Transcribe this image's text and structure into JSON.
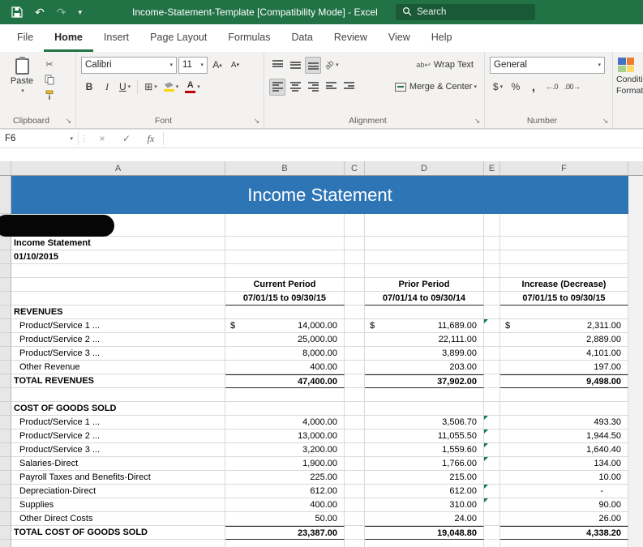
{
  "titlebar": {
    "title": "Income-Statement-Template [Compatibility Mode] - Excel",
    "search_placeholder": "Search"
  },
  "menubar": {
    "tabs": [
      "File",
      "Home",
      "Insert",
      "Page Layout",
      "Formulas",
      "Data",
      "Review",
      "View",
      "Help"
    ]
  },
  "ribbon": {
    "groups": {
      "clipboard": "Clipboard",
      "font": "Font",
      "alignment": "Alignment",
      "number": "Number"
    },
    "paste_label": "Paste",
    "font_name": "Calibri",
    "font_size": "11",
    "wrap_text": "Wrap Text",
    "merge_center": "Merge & Center",
    "number_format": "General",
    "cf_line1": "Conditional",
    "cf_line2": "Formatting"
  },
  "formula_bar": {
    "name_box": "F6"
  },
  "icons": {
    "undo": "↶",
    "redo": "↷",
    "dropdown": "▾",
    "up_small": "▴",
    "scissors": "✂",
    "bold": "B",
    "italic": "I",
    "underline": "U",
    "grow_font": "A",
    "shrink_font": "A",
    "borders": "⊞",
    "font_color_letter": "A",
    "orientation": "ab",
    "wrap_ab": "ab",
    "wrap_arrow": "↩",
    "dollar": "$",
    "percent": "%",
    "comma": ",",
    "increase_decimal": "←.0",
    "decrease_decimal": ".00→",
    "launcher": "↘",
    "cancel": "×",
    "enter": "✓",
    "fx": "fx",
    "dots": "⋮"
  },
  "sheet": {
    "col_headers": [
      "A",
      "B",
      "C",
      "D",
      "E",
      "F"
    ],
    "banner": "Income Statement",
    "doc_title": "Income Statement",
    "doc_date": "01/10/2015",
    "currency_symbol": "$",
    "periods": {
      "current": {
        "title": "Current Period",
        "range": "07/01/15 to 09/30/15"
      },
      "prior": {
        "title": "Prior Period",
        "range": "07/01/14 to 09/30/14"
      },
      "increase": {
        "title": "Increase (Decrease)",
        "range": "07/01/15 to 09/30/15"
      }
    },
    "revenues": {
      "header": "REVENUES",
      "rows": [
        {
          "label": "Product/Service 1 ...",
          "current": "14,000.00",
          "prior": "11,689.00",
          "increase": "2,311.00"
        },
        {
          "label": "Product/Service 2 ...",
          "current": "25,000.00",
          "prior": "22,111.00",
          "increase": "2,889.00"
        },
        {
          "label": "Product/Service 3 ...",
          "current": "8,000.00",
          "prior": "3,899.00",
          "increase": "4,101.00"
        },
        {
          "label": "Other Revenue",
          "current": "400.00",
          "prior": "203.00",
          "increase": "197.00"
        }
      ],
      "total": {
        "label": "TOTAL REVENUES",
        "current": "47,400.00",
        "prior": "37,902.00",
        "increase": "9,498.00"
      }
    },
    "cogs": {
      "header": "COST OF GOODS SOLD",
      "rows": [
        {
          "label": "Product/Service 1 ...",
          "current": "4,000.00",
          "prior": "3,506.70",
          "increase": "493.30"
        },
        {
          "label": "Product/Service 2 ...",
          "current": "13,000.00",
          "prior": "11,055.50",
          "increase": "1,944.50"
        },
        {
          "label": "Product/Service 3 ...",
          "current": "3,200.00",
          "prior": "1,559.60",
          "increase": "1,640.40"
        },
        {
          "label": "Salaries-Direct",
          "current": "1,900.00",
          "prior": "1,766.00",
          "increase": "134.00"
        },
        {
          "label": "Payroll Taxes and Benefits-Direct",
          "current": "225.00",
          "prior": "215.00",
          "increase": "10.00"
        },
        {
          "label": "Depreciation-Direct",
          "current": "612.00",
          "prior": "612.00",
          "increase": "-"
        },
        {
          "label": "Supplies",
          "current": "400.00",
          "prior": "310.00",
          "increase": "90.00"
        },
        {
          "label": "Other Direct Costs",
          "current": "50.00",
          "prior": "24.00",
          "increase": "26.00"
        }
      ],
      "total": {
        "label": "TOTAL COST OF GOODS SOLD",
        "current": "23,387.00",
        "prior": "19,048.80",
        "increase": "4,338.20"
      }
    }
  }
}
